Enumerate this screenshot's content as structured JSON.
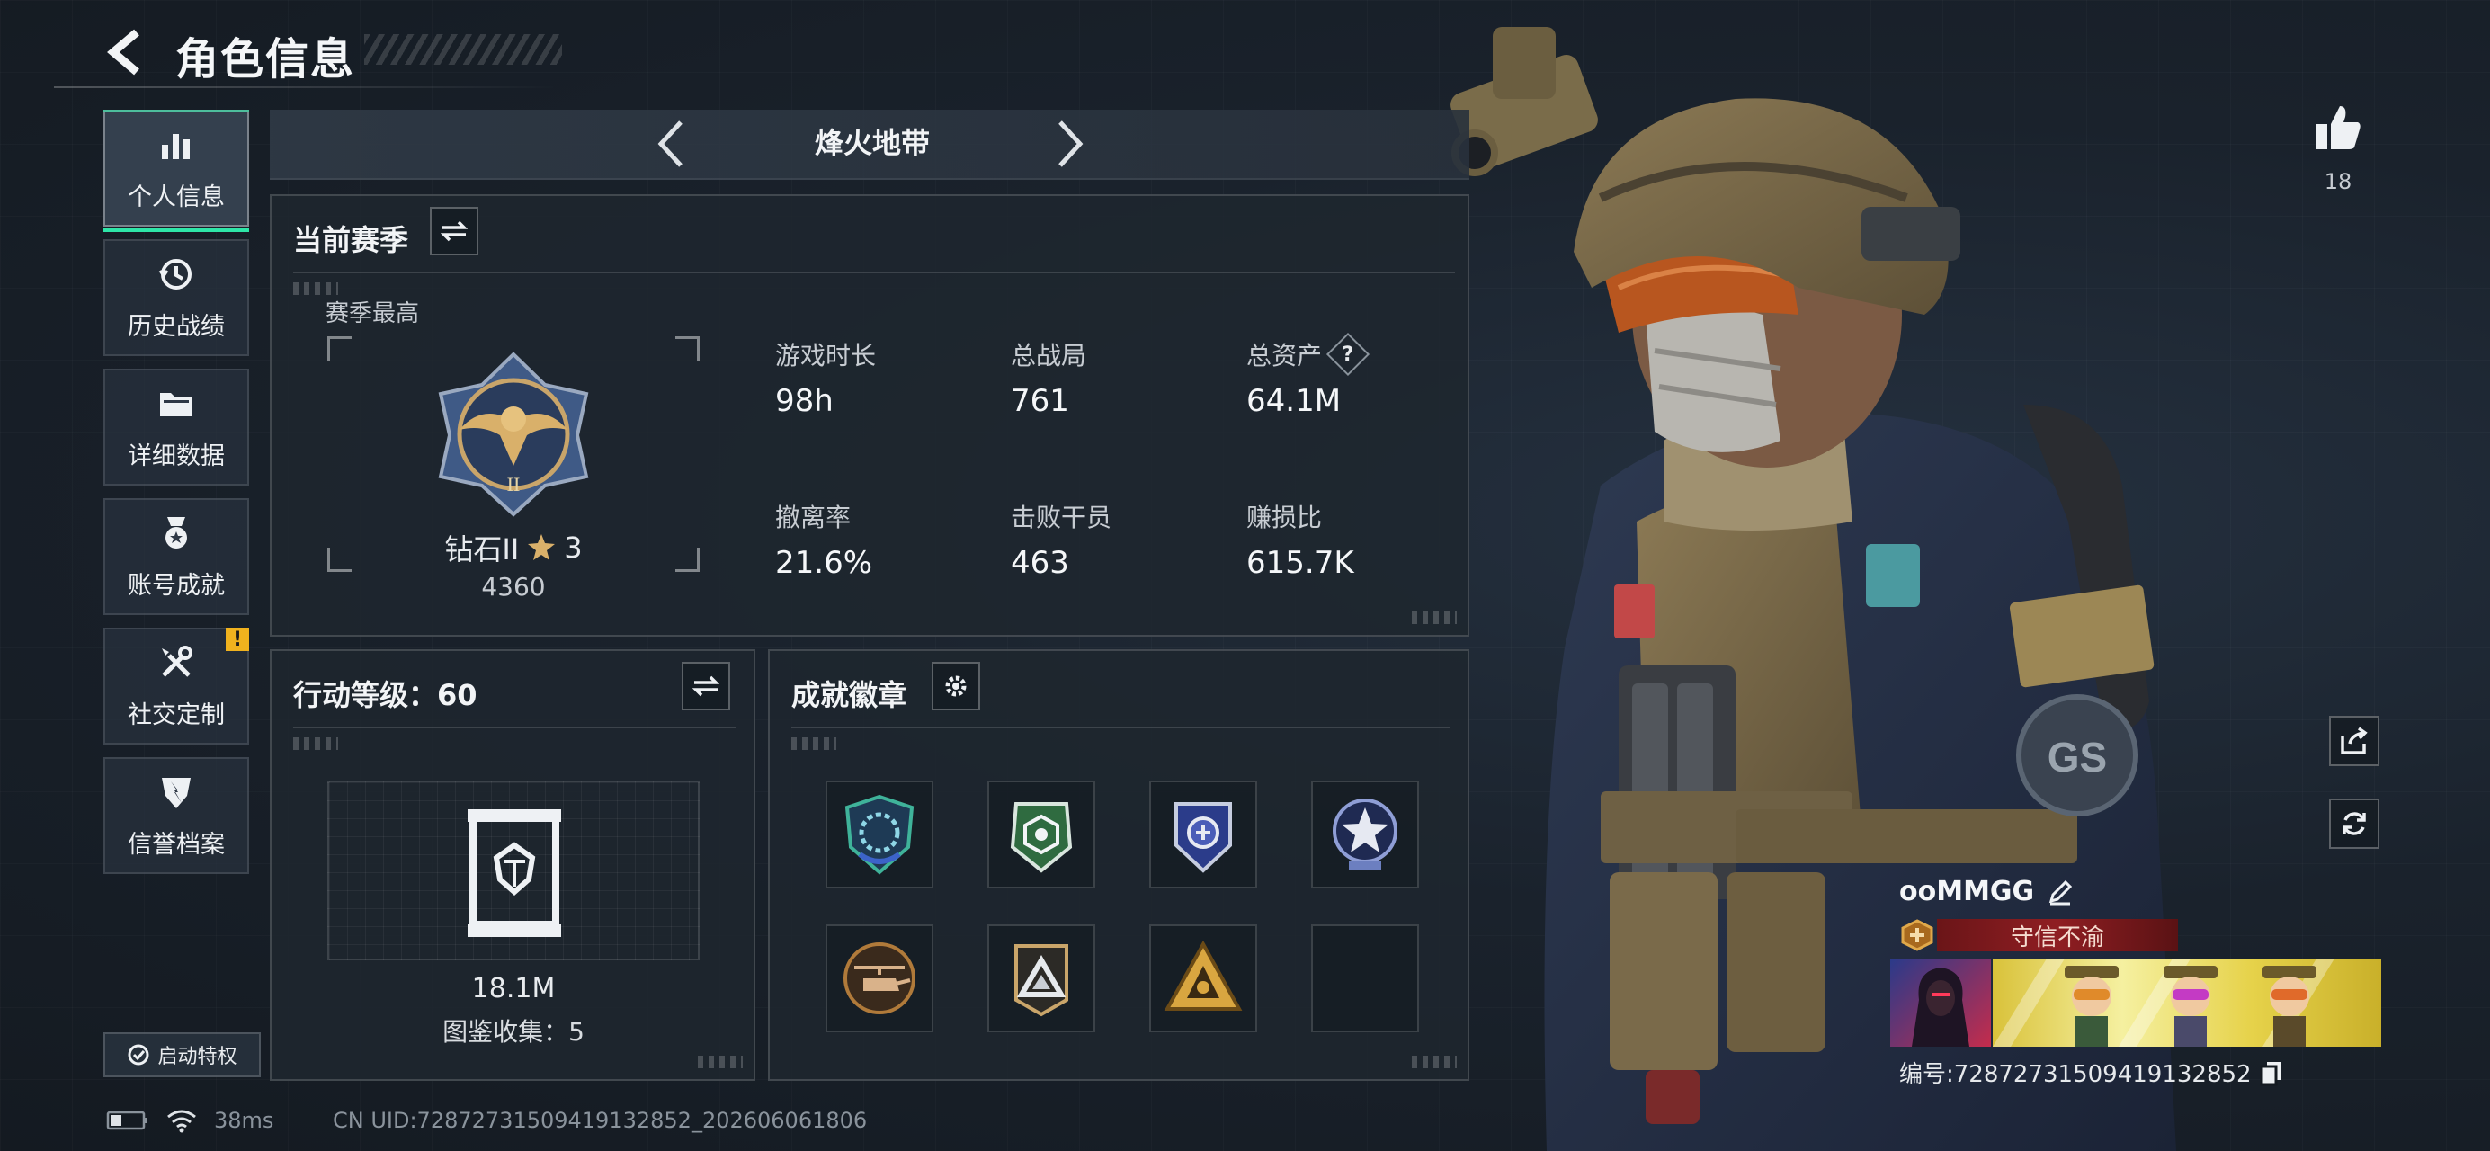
{
  "header": {
    "title": "角色信息"
  },
  "sidebar": {
    "items": [
      {
        "label": "个人信息",
        "icon": "bar-chart-icon",
        "active": true
      },
      {
        "label": "历史战绩",
        "icon": "history-clock-icon"
      },
      {
        "label": "详细数据",
        "icon": "folder-icon"
      },
      {
        "label": "账号成就",
        "icon": "achievement-medal-icon"
      },
      {
        "label": "社交定制",
        "icon": "tools-icon",
        "alert": "!"
      },
      {
        "label": "信誉档案",
        "icon": "credit-shield-icon"
      }
    ],
    "privilege_label": "启动特权"
  },
  "mode": {
    "title": "烽火地带"
  },
  "season": {
    "title": "当前赛季",
    "best_label": "赛季最高",
    "rank_name": "钻石II",
    "rank_stars": "3",
    "rank_points": "4360",
    "stats": [
      {
        "label": "游戏时长",
        "value": "98h"
      },
      {
        "label": "总战局",
        "value": "761"
      },
      {
        "label": "总资产",
        "value": "64.1M",
        "help": "?"
      },
      {
        "label": "撤离率",
        "value": "21.6%"
      },
      {
        "label": "击败干员",
        "value": "463"
      },
      {
        "label": "赚损比",
        "value": "615.7K"
      }
    ]
  },
  "action_level": {
    "title": "行动等级：60",
    "value": "18.1M",
    "collection": "图鉴收集：5"
  },
  "achievements": {
    "title": "成就徽章",
    "badges": [
      {
        "icon": "gears-shield-badge-icon",
        "color": "#3fb39a"
      },
      {
        "icon": "green-hex-badge-icon",
        "color": "#3e8c54"
      },
      {
        "icon": "blue-shield-badge-icon",
        "color": "#4a5db8"
      },
      {
        "icon": "star-badge-icon",
        "color": "#6c7fc0"
      },
      {
        "icon": "helicopter-badge-icon",
        "color": "#b07a3a"
      },
      {
        "icon": "triangle-badge-icon",
        "color": "#c9ced4"
      },
      {
        "icon": "gold-triangle-badge-icon",
        "color": "#d9a640"
      },
      {
        "icon": "empty-slot-icon",
        "color": ""
      }
    ]
  },
  "player": {
    "likes": "18",
    "name": "ooMMGG",
    "title": "守信不渝",
    "id": "编号:7287273150941913285​2"
  },
  "status_bar": {
    "ping": "38ms",
    "uid": "CN UID:7287273150941913285​2_202606061806"
  },
  "colors": {
    "accent": "#2ee6a8",
    "alert": "#f0b21e",
    "title_red": "#8f1e22"
  }
}
